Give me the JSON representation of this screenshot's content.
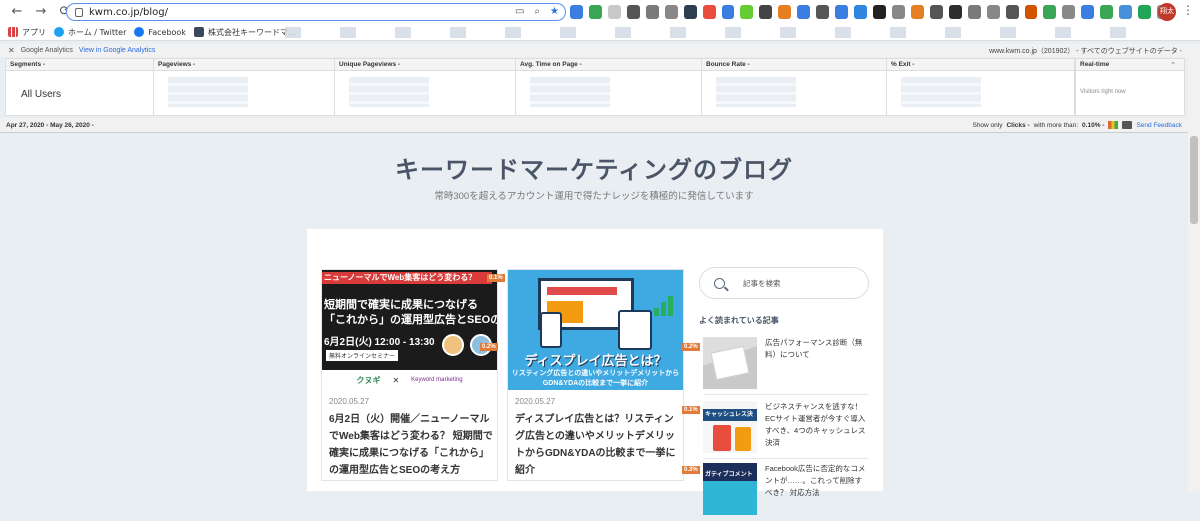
{
  "browser": {
    "url": "kwm.co.jp/blog/",
    "back_icon": "←",
    "forward_icon": "→",
    "reload_icon": "⟳",
    "profile_label": "翔太",
    "menu_icon": "⋮",
    "extension_colors": [
      "#3b7de0",
      "#3aa655",
      "#c9c9c9",
      "#555",
      "#7a7a7a",
      "#888",
      "#2c3e50",
      "#e74c3c",
      "#3b7de0",
      "#6c3",
      "#444",
      "#e67e22",
      "#3b7de0",
      "#555",
      "#3b7de0",
      "#2e86de",
      "#222",
      "#888",
      "#e67e22",
      "#555",
      "#2d2d2d",
      "#7a7a7a",
      "#888",
      "#555",
      "#d35400",
      "#3aa655",
      "#888",
      "#3b7de0",
      "#3aa655",
      "#4a90d9",
      "#22a559",
      "#888"
    ]
  },
  "bookmarks": {
    "apps": "アプリ",
    "twitter": "ホーム / Twitter",
    "facebook": "Facebook",
    "company": "株式会社キーワードマ..."
  },
  "ga": {
    "brand": "Google Analytics",
    "view_link": "View in Google Analytics",
    "property": "www.kwm.co.jp（201902） - すべてのウェブサイトのデータ -",
    "columns": [
      {
        "label": "Segments -"
      },
      {
        "label": "Pageviews -"
      },
      {
        "label": "Unique Pageviews -"
      },
      {
        "label": "Avg. Time on Page -"
      },
      {
        "label": "Bounce Rate -"
      },
      {
        "label": "% Exit -"
      }
    ],
    "segment_value": "All Users",
    "realtime_label": "Real-time",
    "realtime_sub": "Visitors right now",
    "date_range": "Apr 27, 2020 - May 26, 2020 -",
    "show_only": "Show only",
    "clicks": "Clicks -",
    "with_more": "with more than:",
    "threshold": "0.10% -",
    "send_feedback": "Send Feedback"
  },
  "blog": {
    "title": "キーワードマーケティングのブログ",
    "subtitle": "常時300を超えるアカウント運用で得たナレッジを積極的に発信しています",
    "cards": [
      {
        "date": "2020.05.27",
        "title": "6月2日（火）開催／ニューノーマルでWeb集客はどう変わる？ 短期間で確実に成果につなげる「これから」の運用型広告とSEOの考え方",
        "pct": "0.1%",
        "thumb_banner": "ニューノーマルでWeb集客はどう変わる？",
        "thumb_line2": "短期間で確実に成果につなげる",
        "thumb_line3": "「これから」の運用型広告とSEOの考え方",
        "thumb_line4": "6月2日(火) 12:00 - 13:30",
        "thumb_badge": "無料オンラインセミナー",
        "thumb_logo1": "クヌギ",
        "thumb_x": "✕",
        "thumb_logo2": "Keyword marketing"
      },
      {
        "date": "2020.05.27",
        "title": "ディスプレイ広告とは？リスティング広告との違いやメリットデメリットからGDN&YDAの比較まで一挙に紹介",
        "pct": "0.2%",
        "pct2": "0.1%",
        "pct3": "0.3%",
        "thumb_caption": "ディスプレイ広告とは？",
        "thumb_caption2": "リスティング広告との違いやメリットデメリットから",
        "thumb_caption3": "GDN&YDAの比較まで一挙に紹介"
      }
    ],
    "search_placeholder": "記事を検索",
    "popular_title": "よく読まれている記事",
    "popular": [
      {
        "text": "広告パフォーマンス診断（無料）について"
      },
      {
        "text": "ビジネスチャンスを逃すな！ECサイト運営者が今すぐ導入すべき、4つのキャッシュレス決済",
        "thumb_caption": "キャッシュレス決"
      },
      {
        "text": "Facebook広告に否定的なコメントが……。これって削除すべき？ 対応方法",
        "thumb_caption": "ガティブコメント"
      }
    ]
  }
}
